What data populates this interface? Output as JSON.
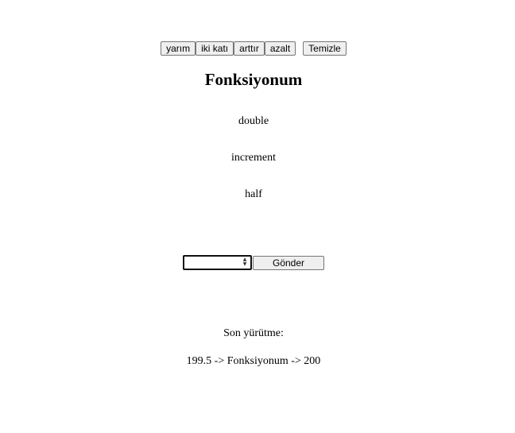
{
  "toolbar": {
    "half_label": "yarım",
    "double_label": "iki katı",
    "increment_label": "arttır",
    "decrement_label": "azalt",
    "clear_label": "Temizle"
  },
  "page": {
    "title": "Fonksiyonum"
  },
  "function_list": [
    "double",
    "increment",
    "half"
  ],
  "form": {
    "input_value": "",
    "submit_label": "Gönder"
  },
  "last_execution": {
    "label": "Son yürütme:",
    "result": "199.5 -> Fonksiyonum -> 200"
  }
}
